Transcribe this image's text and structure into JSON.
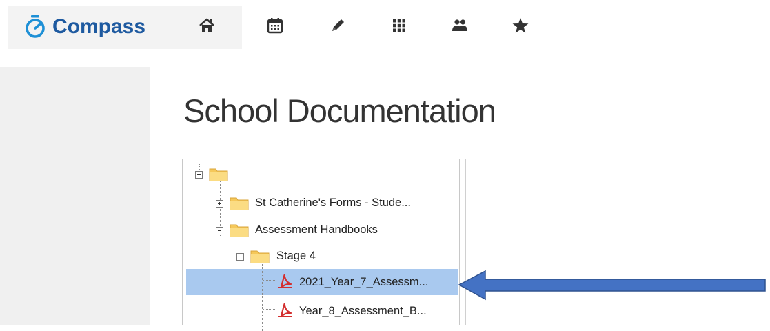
{
  "app": {
    "brand_name": "Compass",
    "accent_color": "#1e5aa0"
  },
  "nav": {
    "icons": [
      "home-icon",
      "calendar-icon",
      "pencil-icon",
      "grid-icon",
      "people-icon",
      "star-icon"
    ]
  },
  "page": {
    "title": "School Documentation"
  },
  "tree": {
    "nodes": [
      {
        "label": "St Catherine's Forms - Stude...",
        "type": "folder"
      },
      {
        "label": "Assessment Handbooks",
        "type": "folder"
      },
      {
        "label": "Stage 4",
        "type": "folder"
      },
      {
        "label": "2021_Year_7_Assessm...",
        "type": "pdf",
        "selected": true
      },
      {
        "label": "Year_8_Assessment_B...",
        "type": "pdf"
      }
    ],
    "selection_color": "#a9c9ef"
  },
  "annotation": {
    "arrow_color": "#4472c4"
  }
}
